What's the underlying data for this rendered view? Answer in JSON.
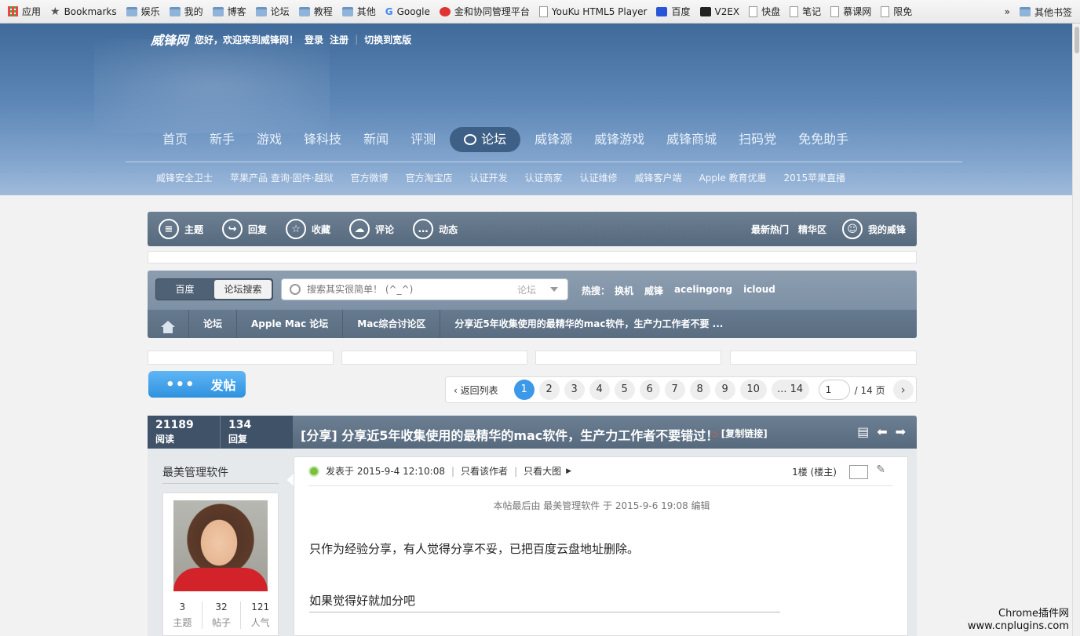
{
  "bookmarks": {
    "items": [
      {
        "label": "应用",
        "icon": "apps-icon"
      },
      {
        "label": "Bookmarks",
        "icon": "star-icon"
      },
      {
        "label": "娱乐",
        "icon": "folder-icon"
      },
      {
        "label": "我的",
        "icon": "folder-icon"
      },
      {
        "label": "博客",
        "icon": "folder-icon"
      },
      {
        "label": "论坛",
        "icon": "folder-icon"
      },
      {
        "label": "教程",
        "icon": "folder-icon"
      },
      {
        "label": "其他",
        "icon": "folder-icon"
      },
      {
        "label": "Google",
        "icon": "google-icon"
      },
      {
        "label": "金和协同管理平台",
        "icon": "site-icon"
      },
      {
        "label": "YouKu HTML5 Player",
        "icon": "page-icon"
      },
      {
        "label": "百度",
        "icon": "baidu-icon"
      },
      {
        "label": "V2EX",
        "icon": "v2ex-icon"
      },
      {
        "label": "快盘",
        "icon": "page-icon"
      },
      {
        "label": "笔记",
        "icon": "page-icon"
      },
      {
        "label": "慕课网",
        "icon": "page-icon"
      },
      {
        "label": "限免",
        "icon": "page-icon"
      }
    ],
    "overflow": "»",
    "other": "其他书签"
  },
  "header": {
    "logo": "威锋网",
    "welcome": "您好，欢迎来到威锋网！",
    "login": "登录",
    "register": "注册",
    "divider": "|",
    "switch": "切换到宽版"
  },
  "main_nav": [
    "首页",
    "新手",
    "游戏",
    "锋科技",
    "新闻",
    "评测",
    "论坛",
    "威锋源",
    "威锋游戏",
    "威锋商城",
    "扫码党",
    "免免助手"
  ],
  "main_nav_active": "论坛",
  "sub_nav": [
    "威锋安全卫士",
    "苹果产品 查询·固件·越狱",
    "官方微博",
    "官方淘宝店",
    "认证开发",
    "认证商家",
    "认证维修",
    "威锋客户端",
    "Apple 教育优惠",
    "2015苹果直播"
  ],
  "toolbar": {
    "items": [
      {
        "label": "主题",
        "glyph": "≡"
      },
      {
        "label": "回复",
        "glyph": "↪"
      },
      {
        "label": "收藏",
        "glyph": "☆"
      },
      {
        "label": "评论",
        "glyph": "☁"
      },
      {
        "label": "动态",
        "glyph": "…"
      }
    ],
    "hot": "最新热门",
    "digest": "精华区",
    "my": "我的威锋"
  },
  "search": {
    "engine_baidu": "百度",
    "engine_forum": "论坛搜索",
    "placeholder": "搜索其实很简单！ (^_^)",
    "scope": "论坛",
    "hot_label": "热搜：",
    "hot_terms": [
      "换机",
      "威锋",
      "acelingong",
      "icloud"
    ]
  },
  "breadcrumb": [
    "论坛",
    "Apple Mac 论坛",
    "Mac综合讨论区",
    "分享近5年收集使用的最精华的mac软件，生产力工作者不要 ..."
  ],
  "post_button": {
    "dots": "•••",
    "label": "发帖"
  },
  "pager": {
    "back": "返回列表",
    "pages": [
      "1",
      "2",
      "3",
      "4",
      "5",
      "6",
      "7",
      "8",
      "9",
      "10",
      "... 14"
    ],
    "current": "1",
    "input_value": "1",
    "total": "/ 14 页",
    "next": "›"
  },
  "thread": {
    "views": "21189",
    "views_label": "阅读",
    "replies": "134",
    "replies_label": "回复",
    "title": "[分享] 分享近5年收集使用的最精华的mac软件，生产力工作者不要错过！",
    "copy_link": "[复制链接]"
  },
  "author": {
    "name": "最美管理软件",
    "stats": [
      {
        "value": "3",
        "label": "主题"
      },
      {
        "value": "32",
        "label": "帖子"
      },
      {
        "value": "121",
        "label": "人气"
      }
    ]
  },
  "post": {
    "posted_at": "发表于 2015-9-4 12:10:08",
    "only_author": "只看该作者",
    "big_image": "只看大图",
    "floor": "1楼 (楼主)",
    "edit_note": "本帖最后由 最美管理软件 于 2015-9-6 19:08 编辑",
    "text1": "只作为经验分享，有人觉得分享不妥，已把百度云盘地址删除。",
    "text2": "如果觉得好就加分吧"
  },
  "watermark": {
    "line1": "Chrome插件网",
    "line2": "www.cnplugins.com"
  }
}
